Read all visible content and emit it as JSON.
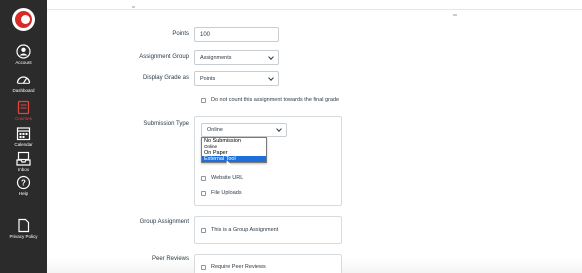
{
  "nav": {
    "items": [
      {
        "label": "Account",
        "icon": "account-icon"
      },
      {
        "label": "Dashboard",
        "icon": "dashboard-icon"
      },
      {
        "label": "Courses",
        "icon": "courses-icon",
        "active": true
      },
      {
        "label": "Calendar",
        "icon": "calendar-icon"
      },
      {
        "label": "Inbox",
        "icon": "inbox-icon"
      },
      {
        "label": "Help",
        "icon": "help-icon"
      },
      {
        "label": "Privacy Policy",
        "icon": "document-icon"
      }
    ],
    "active_color": "#e0453c",
    "background": "#2b2b2b"
  },
  "form": {
    "points": {
      "label": "Points",
      "value": "100"
    },
    "assignment_group": {
      "label": "Assignment Group",
      "value": "Assignments"
    },
    "display_grade": {
      "label": "Display Grade as",
      "value": "Points"
    },
    "no_count": {
      "label": "Do not count this assignment towards the final grade",
      "checked": false
    },
    "submission_type": {
      "label": "Submission Type",
      "value": "Online",
      "options": [
        "No Submission",
        "Online",
        "On Paper",
        "External Tool"
      ],
      "highlighted": "External Tool",
      "online_entry_options": [
        "Website URL",
        "File Uploads"
      ]
    },
    "group_assignment": {
      "label": "Group Assignment",
      "checkbox": "This is a Group Assignment"
    },
    "peer_reviews": {
      "label": "Peer Reviews",
      "checkbox": "Require Peer Reviews"
    }
  }
}
